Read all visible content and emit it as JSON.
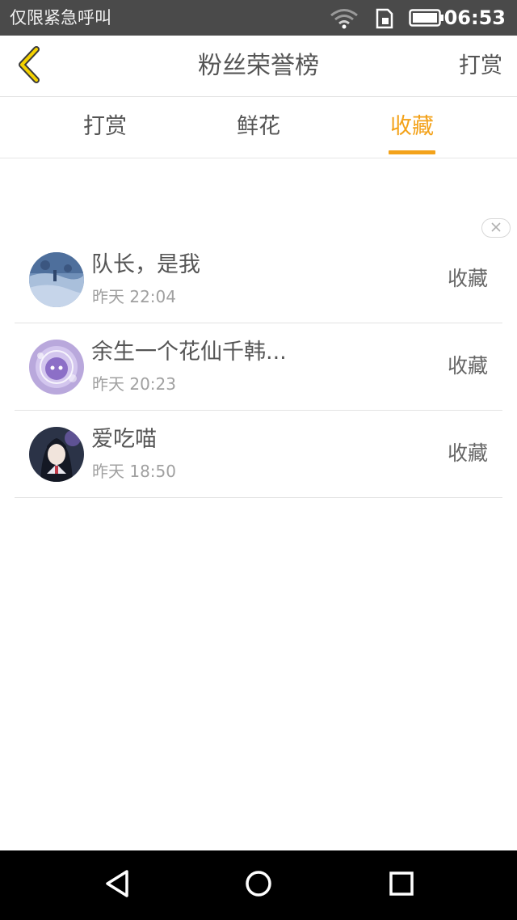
{
  "status_bar": {
    "carrier": "仅限紧急呼叫",
    "time": "06:53",
    "icons": [
      "wifi-icon",
      "sim-card-icon",
      "battery-icon"
    ]
  },
  "header": {
    "title": "粉丝荣誉榜",
    "action": "打赏",
    "back_icon": "chevron-left-icon"
  },
  "tabs": [
    {
      "label": "打赏",
      "active": false
    },
    {
      "label": "鲜花",
      "active": false
    },
    {
      "label": "收藏",
      "active": true
    }
  ],
  "list": [
    {
      "name": "队长，是我",
      "time": "昨天 22:04",
      "action": "收藏",
      "avatar": "avatar-snow-scene"
    },
    {
      "name": "余生一个花仙千韩...",
      "time": "昨天 20:23",
      "action": "收藏",
      "avatar": "avatar-purple-character"
    },
    {
      "name": "爱吃喵",
      "time": "昨天 18:50",
      "action": "收藏",
      "avatar": "avatar-anime-girl"
    }
  ],
  "colors": {
    "accent": "#f3a21a",
    "status_bar": "#4a4a4a",
    "nav_bar": "#000000",
    "text": "#555555",
    "subtext": "#a0a0a0"
  },
  "nav_bar": {
    "icons": [
      "back-triangle-icon",
      "home-circle-icon",
      "recents-square-icon"
    ]
  }
}
